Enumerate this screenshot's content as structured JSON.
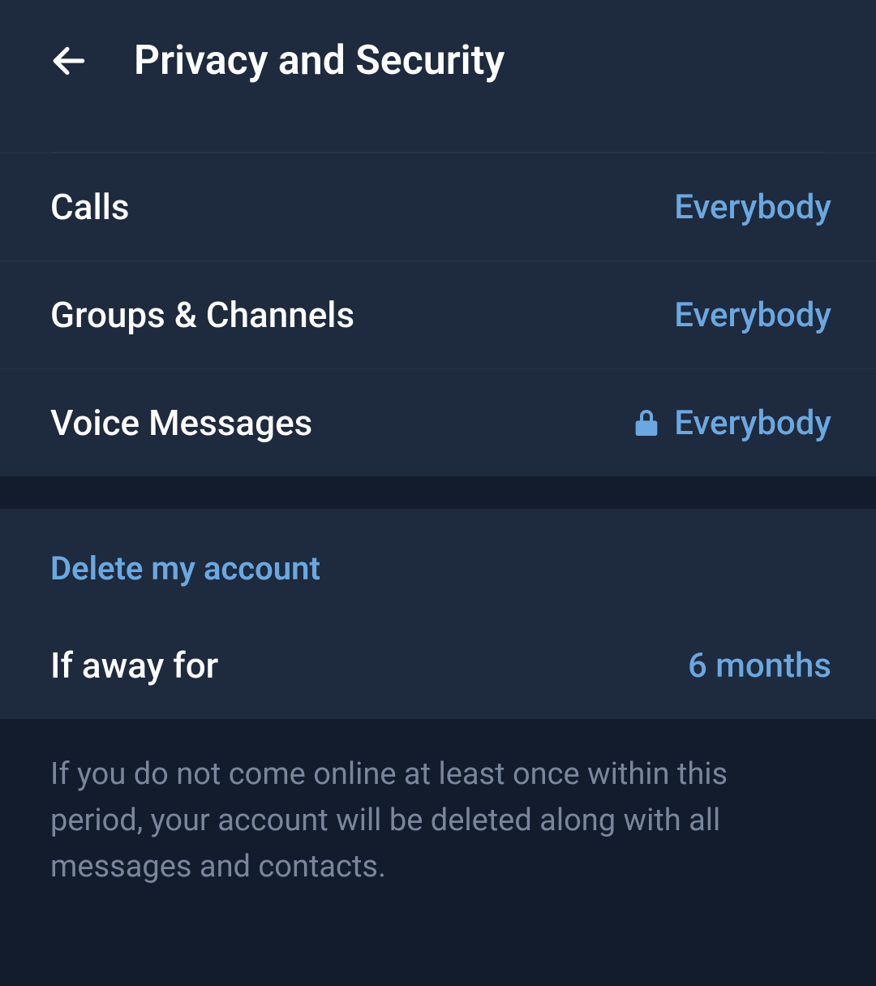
{
  "header": {
    "title": "Privacy and Security"
  },
  "privacy_items": [
    {
      "label": "Calls",
      "value": "Everybody",
      "locked": false
    },
    {
      "label": "Groups & Channels",
      "value": "Everybody",
      "locked": false
    },
    {
      "label": "Voice Messages",
      "value": "Everybody",
      "locked": true
    }
  ],
  "delete_section": {
    "header": "Delete my account",
    "away_label": "If away for",
    "away_value": "6 months",
    "description": "If you do not come online at least once within this period, your account will be deleted along with all messages and contacts."
  },
  "colors": {
    "accent": "#6ba8e0",
    "bg_dark": "#131c2c",
    "bg_panel": "#1e2a3e"
  }
}
